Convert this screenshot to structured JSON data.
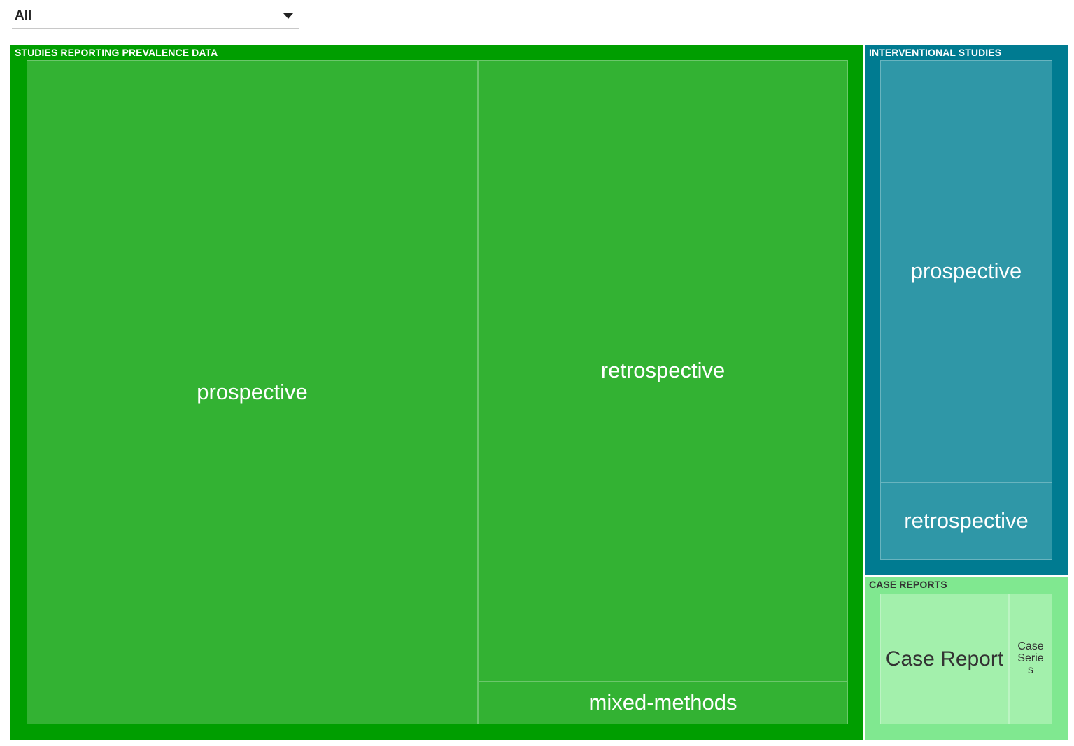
{
  "filter": {
    "selected": "All",
    "icon": "chevron-down-icon"
  },
  "chart_data": {
    "type": "treemap",
    "groups": [
      {
        "name": "STUDIES REPORTING PREVALENCE DATA",
        "color": "#009e00",
        "leaf_color": "#33b233",
        "text_color": "#ffffff",
        "children": [
          {
            "name": "prospective"
          },
          {
            "name": "retrospective"
          },
          {
            "name": "mixed-methods"
          }
        ]
      },
      {
        "name": "INTERVENTIONAL STUDIES",
        "color": "#007b91",
        "leaf_color": "#2f97a7",
        "text_color": "#ffffff",
        "children": [
          {
            "name": "prospective"
          },
          {
            "name": "retrospective"
          }
        ]
      },
      {
        "name": "CASE REPORTS",
        "color": "#80e890",
        "leaf_color": "#a3f0ac",
        "text_color": "#333333",
        "children": [
          {
            "name": "Case Report"
          },
          {
            "name": "Case Series"
          }
        ]
      }
    ]
  }
}
